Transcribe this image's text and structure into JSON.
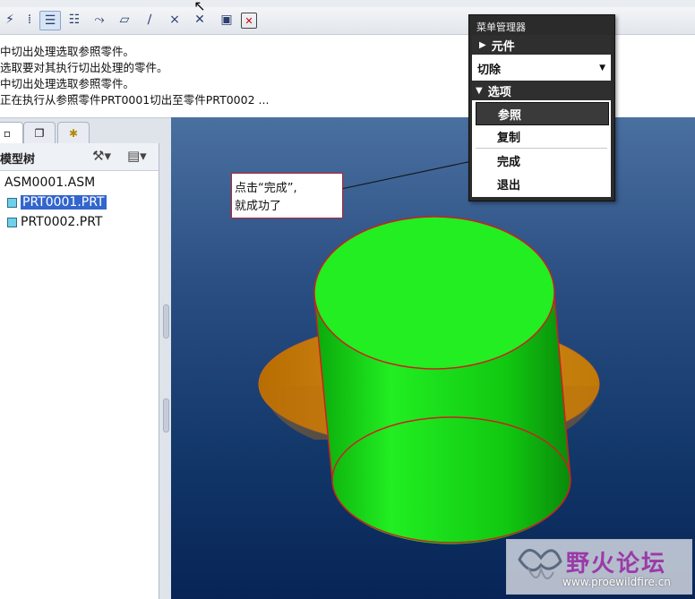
{
  "messages": [
    "中切出处理选取参照零件。",
    "选取要对其执行切出处理的零件。",
    "中切出处理选取参照零件。",
    "正在执行从参照零件PRT0001切出至零件PRT0002 ..."
  ],
  "model_tree": {
    "title": "模型树",
    "root": "ASM0001.ASM",
    "parts": [
      "PRT0001.PRT",
      "PRT0002.PRT"
    ]
  },
  "menu_manager": {
    "title": "菜单管理器",
    "element_header": "元件",
    "cut_option": "切除",
    "options_header": "选项",
    "items": [
      "参照",
      "复制",
      "完成",
      "退出"
    ]
  },
  "callout": {
    "line1": "点击“完成”,",
    "line2": "就成功了"
  },
  "watermark": {
    "title": "野火论坛",
    "url": "www.proewildfire.cn"
  },
  "colors": {
    "viewport_top": "#4a70a0",
    "viewport_bottom": "#082456",
    "cylinder": "#00dd00",
    "disc": "#d08410",
    "edge": "#dd2020",
    "selection": "#3366cc"
  },
  "icons": [
    "cursor-icon",
    "model-tree-icon",
    "layer-icon",
    "favorites-icon",
    "settings-icon",
    "tree-filter-icon",
    "part-icon",
    "triangle-right-icon",
    "triangle-down-icon",
    "dropdown-arrow-icon"
  ]
}
